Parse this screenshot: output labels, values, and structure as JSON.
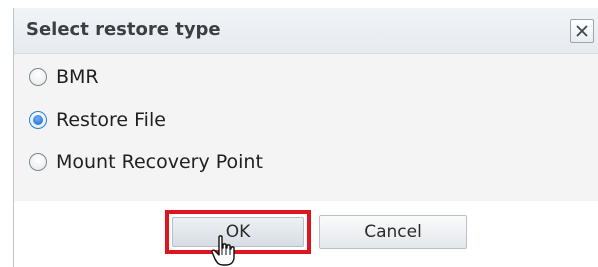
{
  "dialog": {
    "title": "Select restore type",
    "close_icon": "close-icon"
  },
  "options": [
    {
      "label": "BMR",
      "checked": false
    },
    {
      "label": "Restore File",
      "checked": true
    },
    {
      "label": "Mount Recovery Point",
      "checked": false
    }
  ],
  "buttons": {
    "ok_label": "OK",
    "cancel_label": "Cancel"
  },
  "colors": {
    "highlight": "#e0141e",
    "radio_selected": "#1565c8"
  },
  "cursor": "hand-pointer-icon"
}
